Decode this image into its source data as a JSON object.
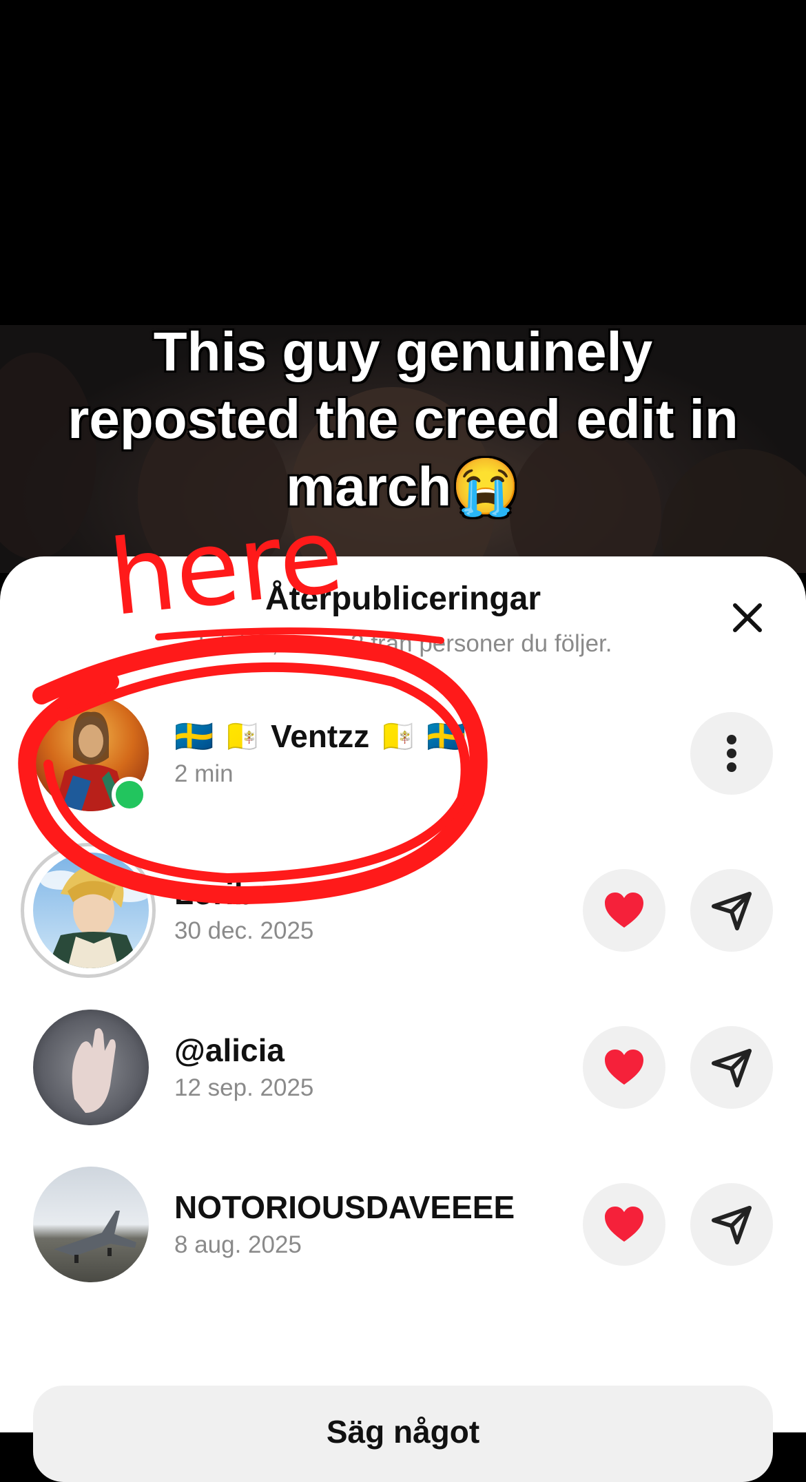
{
  "video": {
    "caption": "This guy genuinely reposted the creed edit in march😭"
  },
  "sheet": {
    "title": "Återpubliceringar",
    "subtitle": "Totalt 7, varav 3 från personer du följer."
  },
  "reposts": [
    {
      "name": "🇸🇪 🇻🇦 Ventzz 🇻🇦 🇸🇪",
      "date": "2 min",
      "online": true
    },
    {
      "name": "Lorib",
      "date": "30 dec. 2025"
    },
    {
      "name": "@alicia",
      "date": "12 sep. 2025"
    },
    {
      "name": "NOTORIOUSDAVEEEE",
      "date": "8 aug. 2025"
    }
  ],
  "annotation": {
    "text": "here",
    "color": "#ff1a1a"
  },
  "footer": {
    "button_label": "Säg något"
  },
  "icons": {
    "close": "close-icon",
    "more": "more-vertical-icon",
    "heart": "heart-icon",
    "send": "send-icon"
  },
  "colors": {
    "heart": "#f5213a",
    "online": "#22c55e",
    "annotation": "#ff1a1a"
  }
}
